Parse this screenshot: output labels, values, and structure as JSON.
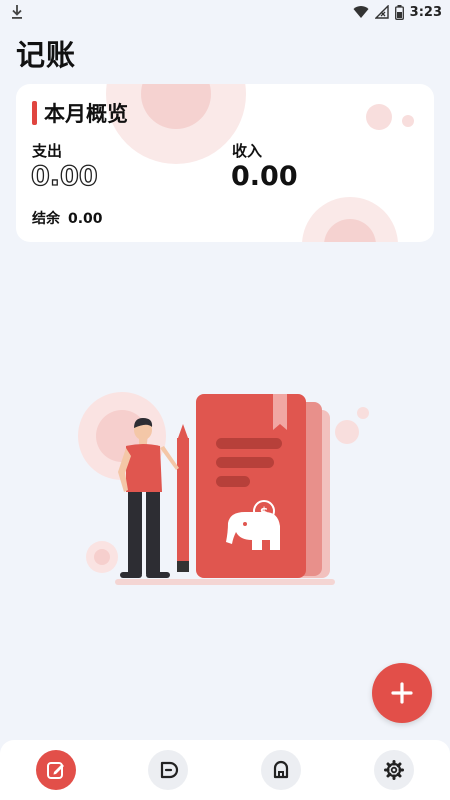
{
  "status_bar": {
    "time": "3:23",
    "icons": [
      "download-icon",
      "wifi-icon",
      "no-signal-icon",
      "battery-icon"
    ]
  },
  "page_title": "记账",
  "summary": {
    "title": "本月概览",
    "expense_label": "支出",
    "expense_value": "0.00",
    "income_label": "收入",
    "income_value": "0.00",
    "balance_label": "结余",
    "balance_value": "0.00"
  },
  "fab": {
    "icon": "plus-icon"
  },
  "bottom_nav": {
    "items": [
      {
        "icon": "edit-icon",
        "active": true
      },
      {
        "icon": "ledger-icon",
        "active": false
      },
      {
        "icon": "wallet-icon",
        "active": false
      },
      {
        "icon": "settings-gear-icon",
        "active": false
      }
    ]
  },
  "colors": {
    "accent": "#e24f49",
    "background": "#f1f4fa",
    "card": "#ffffff"
  }
}
